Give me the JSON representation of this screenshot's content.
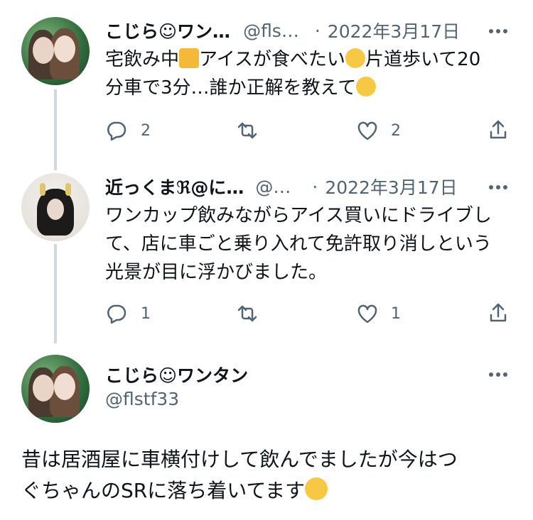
{
  "tweets": [
    {
      "display_name": "こじら☺ワン…",
      "handle": "@fls…",
      "separator": "·",
      "date": "2022年3月17日",
      "text_line1_a": "宅飲み中",
      "text_line1_b": "アイスが食べたい",
      "text_line1_c": "片道歩いて20",
      "text_line2": "分車で3分…誰か正解を教えて",
      "reply_count": "2",
      "like_count": "2"
    },
    {
      "display_name": "近っくまℜ@に…",
      "handle": "@…",
      "separator": "·",
      "date": "2022年3月17日",
      "text_line1": "ワンカップ飲みながらアイス買いにドライブし",
      "text_line2": "て、店に車ごと乗り入れて免許取り消しという",
      "text_line3": "光景が目に浮かびました。",
      "reply_count": "1",
      "like_count": "1"
    }
  ],
  "main_tweet": {
    "display_name": "こじら☺ワンタン",
    "handle": "@flstf33",
    "text_line1": "昔は居酒屋に車横付けして飲んでましたが今はつ",
    "text_line2": "ぐちゃんのSRに落ち着いてます"
  },
  "icons": {
    "more": "more-icon",
    "reply": "reply-icon",
    "retweet": "retweet-icon",
    "like": "like-icon",
    "share": "share-icon",
    "beer": "beer-emoji",
    "confounded": "confounded-emoji",
    "pleading": "rolling-eyes-emoji",
    "yum": "yum-emoji"
  },
  "colors": {
    "text": "#0f1419",
    "muted": "#536471",
    "thread_line": "#cfd9de"
  }
}
